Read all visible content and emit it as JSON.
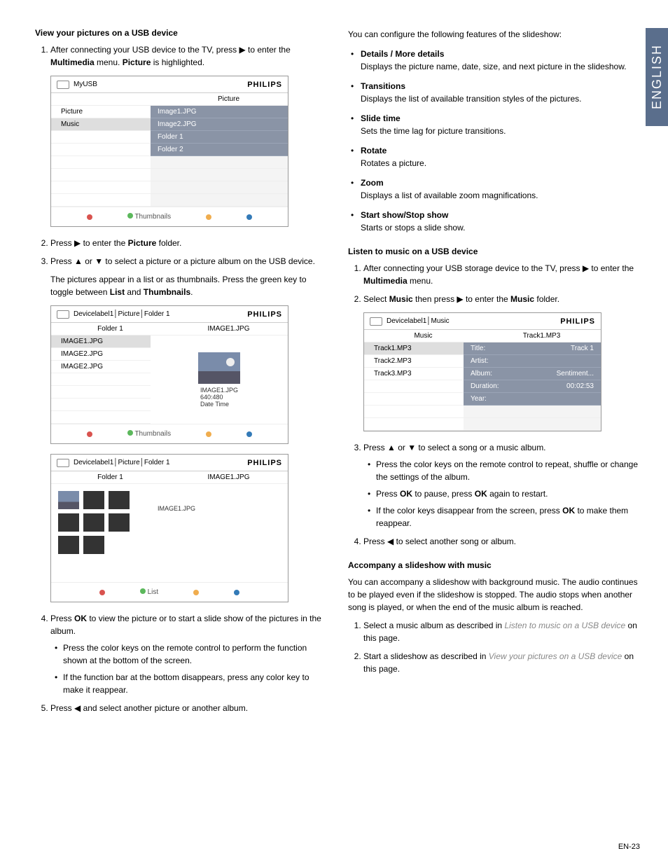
{
  "sideTab": "ENGLISH",
  "pageNum": "EN-23",
  "left": {
    "h1": "View your pictures on a USB device",
    "step1a": "After connecting your USB device to the TV, press ▶ to enter the ",
    "step1b": "Multimedia",
    "step1c": " menu.  ",
    "step1d": "Picture",
    "step1e": " is highlighted.",
    "step2a": "Press ▶ to enter the ",
    "step2b": "Picture",
    "step2c": " folder.",
    "step3": "Press ▲ or ▼ to select a picture or a picture album on the USB device.",
    "step3note1": "The pictures appear in a list or as thumbnails.  Press the green key to toggle between ",
    "step3note1b": "List",
    "step3note1c": " and ",
    "step3note1d": "Thumbnails",
    "step3note1e": ".",
    "step4a": "Press ",
    "step4b": "OK",
    "step4c": " to view the picture or to start a slide show of the pictures in the album.",
    "step4s1": "Press the color keys on the remote control to perform the function shown at the bottom of the screen.",
    "step4s2": "If the function bar at the bottom disappears, press any color key to make it reappear.",
    "step5": "Press ◀ and select another picture or another album."
  },
  "shot1": {
    "crumb": "MyUSB",
    "brand": "PHILIPS",
    "colhdr": "Picture",
    "l1": "Picture",
    "l2": "Music",
    "r1": "Image1.JPG",
    "r2": "Image2.JPG",
    "r3": "Folder 1",
    "r4": "Folder 2",
    "footer": "Thumbnails"
  },
  "shot2": {
    "crumb": "Devicelabel1│Picture│Folder 1",
    "brand": "PHILIPS",
    "lh": "Folder 1",
    "rh": "IMAGE1.JPG",
    "l1": "IMAGE1.JPG",
    "l2": "IMAGE2.JPG",
    "l3": "IMAGE2.JPG",
    "meta1": "IMAGE1.JPG",
    "meta2": "640:480",
    "meta3": "Date   Time",
    "footer": "Thumbnails"
  },
  "shot3": {
    "crumb": "Devicelabel1│Picture│Folder 1",
    "brand": "PHILIPS",
    "lh": "Folder 1",
    "rh": "IMAGE1.JPG",
    "meta1": "IMAGE1.JPG",
    "footer": "List"
  },
  "right": {
    "intro": "You can configure the following features of the slideshow:",
    "f1t": "Details / More details",
    "f1d": "Displays the picture name, date, size, and next picture in the slideshow.",
    "f2t": "Transitions",
    "f2d": "Displays the list of available transition styles of the pictures.",
    "f3t": "Slide time",
    "f3d": "Sets the time lag for picture transitions.",
    "f4t": "Rotate",
    "f4d": "Rotates a picture.",
    "f5t": "Zoom",
    "f5d": "Displays a list of available zoom magnifications.",
    "f6t": "Start show/Stop show",
    "f6d": "Starts or stops a slide show.",
    "h2": "Listen to music on a USB device",
    "m1a": "After connecting your USB storage device to the TV, press ▶ to enter the ",
    "m1b": "Multimedia",
    "m1c": " menu.",
    "m2a": "Select ",
    "m2b": "Music",
    "m2c": " then press ▶ to enter the ",
    "m2d": "Music",
    "m2e": " folder.",
    "m3": "Press ▲ or ▼ to select a song or a music album.",
    "m3s1": "Press the color keys on the remote control to repeat, shuffle or change the settings of the album.",
    "m3s2a": "Press ",
    "m3s2b": "OK",
    "m3s2c": " to pause, press ",
    "m3s2d": "OK",
    "m3s2e": " again to restart.",
    "m3s3a": "If the color keys disappear from the screen, press ",
    "m3s3b": "OK",
    "m3s3c": " to make them reappear.",
    "m4": "Press ◀ to select another song or album.",
    "h3": "Accompany a slideshow with music",
    "acc": "You can accompany a slideshow with background music.  The audio continues to be played even if the slideshow is stopped.  The audio stops when another song is played, or when the end of the music album is reached.",
    "a1a": "Select a music album as described in ",
    "a1b": "Listen to music on a USB device",
    "a1c": " on this page.",
    "a2a": "Start a slideshow as described in ",
    "a2b": "View your pictures on a USB device",
    "a2c": " on this page."
  },
  "shot4": {
    "crumb": "Devicelabel1│Music",
    "brand": "PHILIPS",
    "lh": "Music",
    "rh": "Track1.MP3",
    "l1": "Track1.MP3",
    "l2": "Track2.MP3",
    "l3": "Track3.MP3",
    "r1k": "Title:",
    "r1v": "Track 1",
    "r2k": "Artist:",
    "r2v": "",
    "r3k": "Album:",
    "r3v": "Sentiment...",
    "r4k": "Duration:",
    "r4v": "00:02:53",
    "r5k": "Year:",
    "r5v": ""
  }
}
